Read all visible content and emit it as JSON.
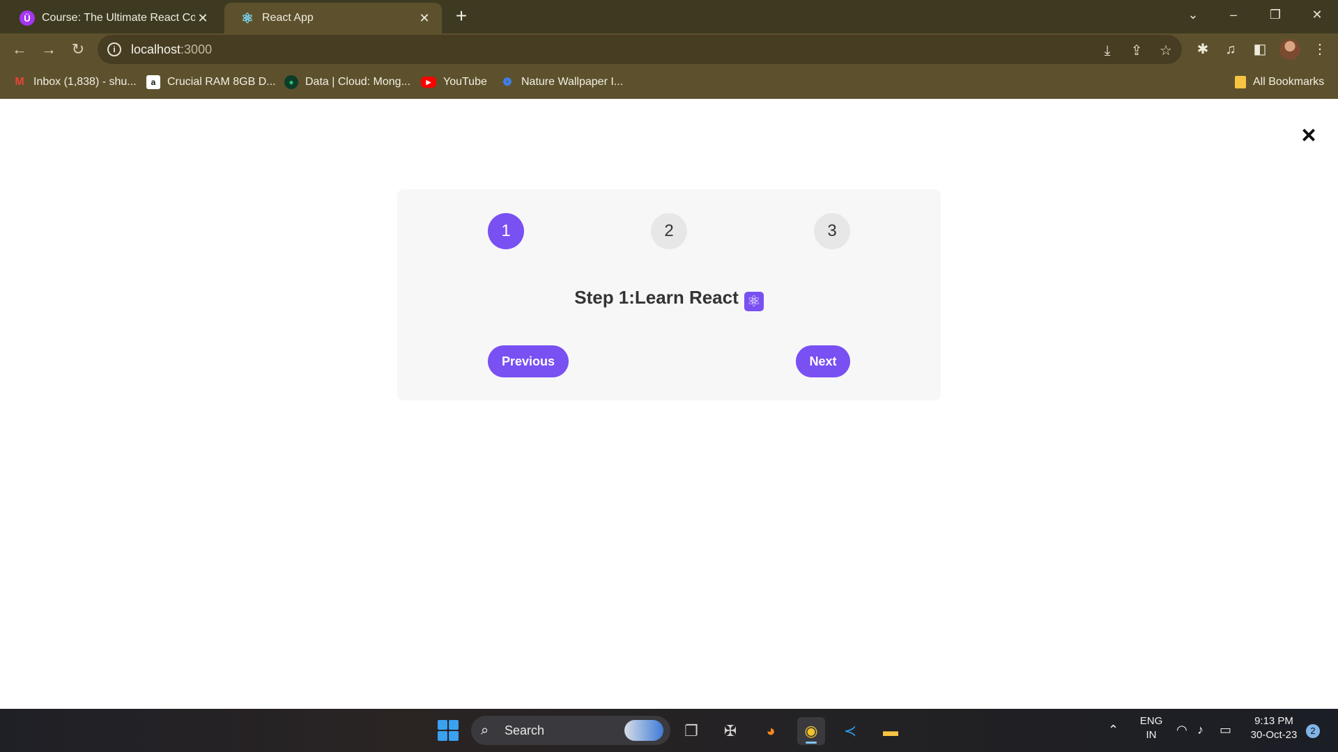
{
  "browser": {
    "tabs": [
      {
        "title": "Course: The Ultimate React Cour",
        "favicon": "udemy-icon",
        "active": false
      },
      {
        "title": "React App",
        "favicon": "react-icon",
        "active": true
      }
    ],
    "address": {
      "host": "localhost",
      "port": ":3000"
    },
    "bookmarks": [
      {
        "label": "Inbox (1,838) - shu...",
        "icon": "gmail-icon"
      },
      {
        "label": "Crucial RAM 8GB D...",
        "icon": "amazon-icon"
      },
      {
        "label": "Data | Cloud: Mong...",
        "icon": "mongodb-icon"
      },
      {
        "label": "YouTube",
        "icon": "youtube-icon"
      },
      {
        "label": "Nature Wallpaper I...",
        "icon": "nature-icon"
      }
    ],
    "all_bookmarks_label": "All Bookmarks"
  },
  "app": {
    "close_symbol": "×",
    "steps": [
      "1",
      "2",
      "3"
    ],
    "active_step": 1,
    "message": "Step 1:Learn React",
    "message_icon": "atom-icon",
    "previous_label": "Previous",
    "next_label": "Next",
    "accent_color": "#7950f2"
  },
  "taskbar": {
    "search_placeholder": "Search",
    "language": "ENG",
    "region": "IN",
    "time": "9:13 PM",
    "date": "30-Oct-23",
    "notifications": "2"
  }
}
